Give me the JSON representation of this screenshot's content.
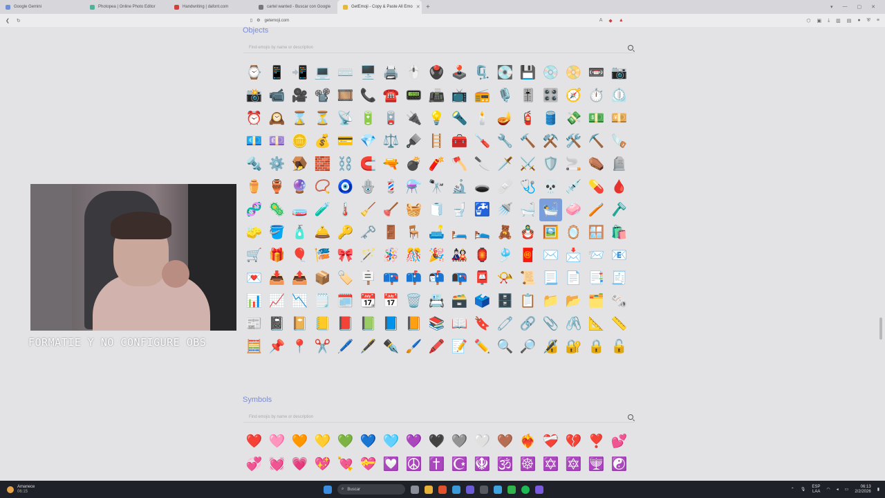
{
  "tabs": [
    {
      "label": "Google Gemini",
      "color": "#6e8fd6"
    },
    {
      "label": "Photopea | Online Photo Editor",
      "color": "#4fb39b"
    },
    {
      "label": "Handwriting | dafont.com",
      "color": "#d2403a"
    },
    {
      "label": "cartel wanted - Buscar con Google",
      "color": "#777777"
    },
    {
      "label": "GetEmoji - Copy & Paste All Emo",
      "color": "#e5b83a",
      "active": true
    }
  ],
  "address": {
    "url": "getemoji.com"
  },
  "sections": {
    "objects": {
      "title": "Objects",
      "search_placeholder": "Find emojis by name or description",
      "emojis": [
        "⌚",
        "📱",
        "📲",
        "💻",
        "⌨️",
        "🖥️",
        "🖨️",
        "🖱️",
        "🖲️",
        "🕹️",
        "🗜️",
        "💽",
        "💾",
        "💿",
        "📀",
        "📼",
        "📷",
        "📸",
        "📹",
        "🎥",
        "📽️",
        "🎞️",
        "📞",
        "☎️",
        "📟",
        "📠",
        "📺",
        "📻",
        "🎙️",
        "🎚️",
        "🎛️",
        "🧭",
        "⏱️",
        "⏲️",
        "⏰",
        "🕰️",
        "⌛",
        "⏳",
        "📡",
        "🔋",
        "🪫",
        "🔌",
        "💡",
        "🔦",
        "🕯️",
        "🪔",
        "🧯",
        "🛢️",
        "💸",
        "💵",
        "💴",
        "💶",
        "💷",
        "🪙",
        "💰",
        "💳",
        "💎",
        "⚖️",
        "🪮",
        "🪜",
        "🧰",
        "🪛",
        "🔧",
        "🔨",
        "⚒️",
        "🛠️",
        "⛏️",
        "🪚",
        "🔩",
        "⚙️",
        "🪤",
        "🧱",
        "⛓️",
        "🧲",
        "🔫",
        "💣",
        "🧨",
        "🪓",
        "🔪",
        "🗡️",
        "⚔️",
        "🛡️",
        "🚬",
        "⚰️",
        "🪦",
        "⚱️",
        "🏺",
        "🔮",
        "📿",
        "🧿",
        "🪬",
        "💈",
        "⚗️",
        "🔭",
        "🔬",
        "🕳️",
        "🩹",
        "🩺",
        "💀",
        "💉",
        "💊",
        "🩸",
        "🧬",
        "🦠",
        "🧫",
        "🧪",
        "🌡️",
        "🧹",
        "🪠",
        "🧺",
        "🧻",
        "🚽",
        "🚰",
        "🚿",
        "🛁",
        "🛀",
        "🧼",
        "🪥",
        "🪒",
        "🧽",
        "🪣",
        "🧴",
        "🛎️",
        "🔑",
        "🗝️",
        "🚪",
        "🪑",
        "🛋️",
        "🛏️",
        "🛌",
        "🧸",
        "🪆",
        "🖼️",
        "🪞",
        "🪟",
        "🛍️",
        "🛒",
        "🎁",
        "🎈",
        "🎏",
        "🎀",
        "🪄",
        "🪅",
        "🎊",
        "🎉",
        "🎎",
        "🏮",
        "🎐",
        "🧧",
        "✉️",
        "📩",
        "📨",
        "📧",
        "💌",
        "📥",
        "📤",
        "📦",
        "🏷️",
        "🪧",
        "📪",
        "📫",
        "📬",
        "📭",
        "📮",
        "📯",
        "📜",
        "📃",
        "📄",
        "📑",
        "🧾",
        "📊",
        "📈",
        "📉",
        "🗒️",
        "🗓️",
        "📆",
        "📅",
        "🗑️",
        "📇",
        "🗃️",
        "🗳️",
        "🗄️",
        "📋",
        "📁",
        "📂",
        "🗂️",
        "🗞️",
        "📰",
        "📓",
        "📔",
        "📒",
        "📕",
        "📗",
        "📘",
        "📙",
        "📚",
        "📖",
        "🔖",
        "🧷",
        "🔗",
        "📎",
        "🖇️",
        "📐",
        "📏",
        "🧮",
        "📌",
        "📍",
        "✂️",
        "🖊️",
        "🖋️",
        "✒️",
        "🖌️",
        "🖍️",
        "📝",
        "✏️",
        "🔍",
        "🔎",
        "🔏",
        "🔐",
        "🔒",
        "🔓"
      ]
    },
    "symbols": {
      "title": "Symbols",
      "search_placeholder": "Find emojis by name or description",
      "emojis": [
        "❤️",
        "🩷",
        "🧡",
        "💛",
        "💚",
        "💙",
        "🩵",
        "💜",
        "🖤",
        "🩶",
        "🤍",
        "🤎",
        "❤️‍🔥",
        "❤️‍🩹",
        "💔",
        "❣️",
        "💕",
        "💞",
        "💓",
        "💗",
        "💖",
        "💘",
        "💝",
        "💟",
        "☮️",
        "✝️",
        "☪️",
        "🪯",
        "🕉️",
        "☸️",
        "✡️",
        "🔯",
        "🕎",
        "☯️"
      ]
    }
  },
  "overlay": {
    "caption": "FORMATIE Y NO CONFIGURE OBS"
  },
  "taskbar": {
    "weather_title": "Amanece",
    "weather_time": "06:15",
    "search_label": "Buscar",
    "lang_top": "ESP",
    "lang_bottom": "LAA",
    "clock_time": "06:13",
    "clock_date": "2/2/2026"
  }
}
